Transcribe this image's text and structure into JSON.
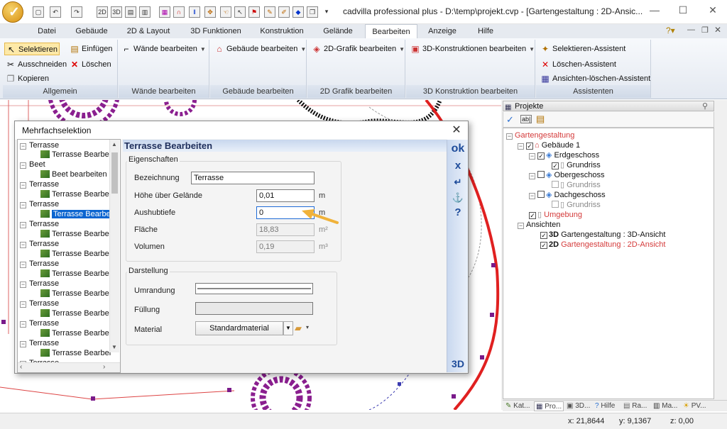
{
  "app": {
    "title": "cadvilla professional plus - D:\\temp\\projekt.cvp - [Gartengestaltung : 2D-Ansic..."
  },
  "tabs": [
    "Datei",
    "Gebäude",
    "2D & Layout",
    "3D Funktionen",
    "Konstruktion",
    "Gelände",
    "Bearbeiten",
    "Anzeige",
    "Hilfe"
  ],
  "active_tab": "Bearbeiten",
  "ribbon": {
    "allgemein": {
      "label": "Allgemein",
      "selektieren": "Selektieren",
      "einfuegen": "Einfügen",
      "ausschneiden": "Ausschneiden",
      "loeschen": "Löschen",
      "kopieren": "Kopieren"
    },
    "waende": {
      "label": "Wände bearbeiten",
      "btn": "Wände bearbeiten"
    },
    "gebaeude": {
      "label": "Gebäude bearbeiten",
      "btn": "Gebäude bearbeiten"
    },
    "grafik2d": {
      "label": "2D Grafik bearbeiten",
      "btn": "2D-Grafik bearbeiten"
    },
    "konstruktion3d": {
      "label": "3D Konstruktion bearbeiten",
      "btn": "3D-Konstruktionen bearbeiten"
    },
    "assistenten": {
      "label": "Assistenten",
      "selektieren": "Selektieren-Assistent",
      "loeschen": "Löschen-Assistent",
      "ansichten": "Ansichten-löschen-Assistent"
    }
  },
  "dialog": {
    "title": "Mehrfachselektion",
    "list": [
      {
        "group": "Terrasse",
        "item": "Terrasse Bearbei"
      },
      {
        "group": "Beet",
        "item": "Beet bearbeiten"
      },
      {
        "group": "Terrasse",
        "item": "Terrasse Bearbei"
      },
      {
        "group": "Terrasse",
        "item": "Terrasse Bearbei"
      },
      {
        "group": "Terrasse",
        "item": "Terrasse Bearbei"
      },
      {
        "group": "Terrasse",
        "item": "Terrasse Bearbei"
      },
      {
        "group": "Terrasse",
        "item": "Terrasse Bearbei"
      },
      {
        "group": "Terrasse",
        "item": "Terrasse Bearbei"
      },
      {
        "group": "Terrasse",
        "item": "Terrasse Bearbei"
      },
      {
        "group": "Terrasse",
        "item": "Terrasse Bearbei"
      },
      {
        "group": "Terrasse",
        "item": "Terrasse Bearbei"
      },
      {
        "group": "Terrasse",
        "item": ""
      }
    ],
    "heading": "Terrasse Bearbeiten",
    "eigenschaften": {
      "label": "Eigenschaften",
      "bezeichnung_label": "Bezeichnung",
      "bezeichnung": "Terrasse",
      "hoehe_label": "Höhe über Gelände",
      "hoehe": "0,01",
      "hoehe_unit": "m",
      "aushub_label": "Aushubtiefe",
      "aushub": "0",
      "aushub_unit": "m",
      "flaeche_label": "Fläche",
      "flaeche": "18,83",
      "flaeche_unit": "m²",
      "volumen_label": "Volumen",
      "volumen": "0,19",
      "volumen_unit": "m³"
    },
    "darstellung": {
      "label": "Darstellung",
      "umrandung_label": "Umrandung",
      "fuellung_label": "Füllung",
      "material_label": "Material",
      "material": "Standardmaterial"
    },
    "side": {
      "ok": "ok",
      "x": "x",
      "help": "?",
      "three_d": "3D"
    }
  },
  "projects": {
    "header": "Projekte",
    "tree": {
      "root": "Gartengestaltung",
      "building": "Gebäude 1",
      "eg": "Erdgeschoss",
      "grundriss1": "Grundriss",
      "og": "Obergeschoss",
      "grundriss2": "Grundriss",
      "dg": "Dachgeschoss",
      "grundriss3": "Grundriss",
      "umgebung": "Umgebung",
      "ansichten": "Ansichten",
      "v3d_tag": "3D",
      "v3d": "Gartengestaltung : 3D-Ansicht",
      "v2d_tag": "2D",
      "v2d": "Gartengestaltung : 2D-Ansicht"
    },
    "bottom_tabs": [
      "Kat...",
      "Pro...",
      "3D...",
      "Hilfe",
      "Ra...",
      "Ma...",
      "PV..."
    ]
  },
  "status": {
    "x": "x: 21,8644",
    "y": "y: 9,1367",
    "z": "z: 0,00"
  },
  "colors": {
    "accent": "#d43b3b",
    "selection": "#0a64d0",
    "arrow": "#f0b23a",
    "hatch": "#8a1f8f"
  }
}
